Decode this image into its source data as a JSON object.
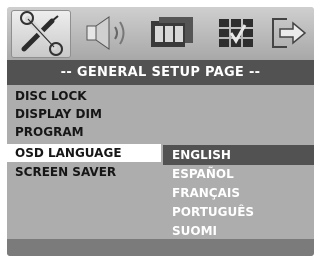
{
  "title": "-- GENERAL SETUP PAGE --",
  "menu": {
    "items": [
      "DISC LOCK",
      "DISPLAY DIM",
      "PROGRAM",
      "OSD LANGUAGE",
      "SCREEN SAVER"
    ]
  },
  "language_options": [
    "ENGLISH",
    "ESPAÑOL",
    "FRANÇAIS",
    "PORTUGUÊS",
    "SUOMI"
  ],
  "icons": [
    "setup-tools-icon",
    "speaker-icon",
    "film-icon",
    "checkbox-grid-icon",
    "exit-arrow-icon"
  ],
  "colors": {
    "background": "#adadad",
    "title_bar": "#525252",
    "selected_menu": "#ffffff",
    "selected_option": "#525252",
    "footer": "#7b7b7b"
  }
}
